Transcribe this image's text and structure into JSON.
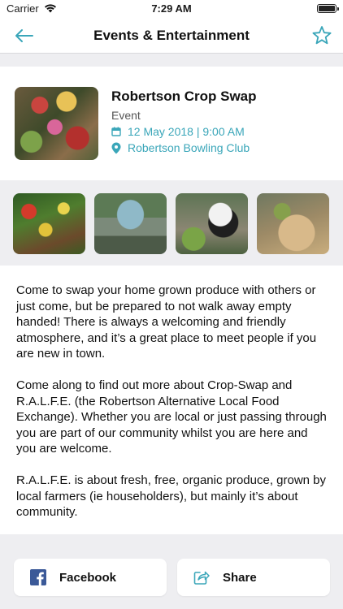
{
  "status_bar": {
    "carrier": "Carrier",
    "time": "7:29 AM"
  },
  "nav": {
    "title": "Events & Entertainment",
    "back_icon": "arrow-left-icon",
    "favorite_icon": "star-outline-icon",
    "accent_color": "#3aa6b9"
  },
  "event": {
    "title": "Robertson Crop Swap",
    "type": "Event",
    "datetime": "12 May 2018 | 9:00 AM",
    "location": "Robertson Bowling Club"
  },
  "gallery": {
    "photos": [
      "produce-photo",
      "market-people-photo",
      "dog-photo",
      "basket-photo"
    ]
  },
  "description": {
    "paragraphs": [
      "Come to swap your home grown produce with others or just come, but be prepared to not walk away empty handed!  There is always a welcoming and friendly atmosphere, and it’s a great place to meet people if you are new in town.",
      "Come along to find out more about Crop-Swap and  R.A.L.F.E. (the Robertson Alternative Local Food Exchange).  Whether you are local or just passing through you are part of our community whilst you are here and you are welcome.",
      "R.A.L.F.E. is about fresh, free, organic produce, grown by local farmers (ie householders), but mainly it’s about community."
    ]
  },
  "actions": {
    "facebook_label": "Facebook",
    "share_label": "Share"
  }
}
